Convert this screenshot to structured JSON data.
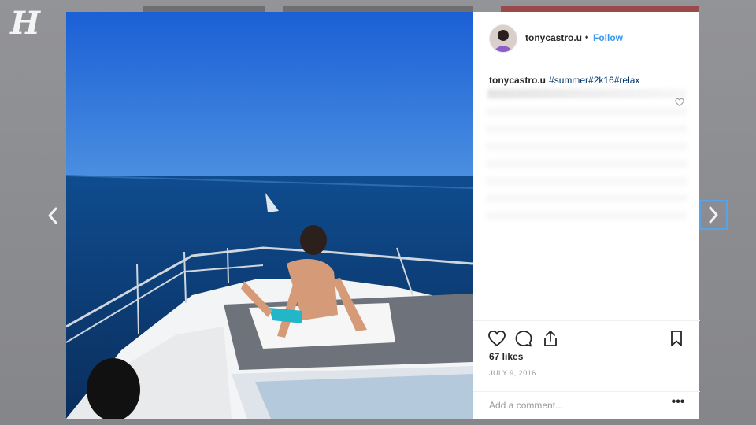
{
  "site": {
    "logo_letter": "H",
    "backdrop_color": "#8e8f93"
  },
  "post": {
    "username": "tonycastro.u",
    "separator": "•",
    "follow_label": "Follow",
    "caption": {
      "username": "tonycastro.u",
      "hashtags": "#summer#2k16#relax"
    },
    "likes": "67 likes",
    "date": "JULY 9, 2016",
    "comment_placeholder": "Add a comment...",
    "more_label": "•••"
  },
  "colors": {
    "link_blue": "#3897f0",
    "hashtag_blue": "#003569",
    "sky": "#1f63d4",
    "sea": "#0e3a76",
    "nav_highlight": "#58a3e6"
  },
  "icons": {
    "nav_prev": "chevron-left-icon",
    "nav_next": "chevron-right-icon",
    "like": "heart-icon",
    "comment": "speech-bubble-icon",
    "share": "share-icon",
    "save": "bookmark-icon"
  }
}
